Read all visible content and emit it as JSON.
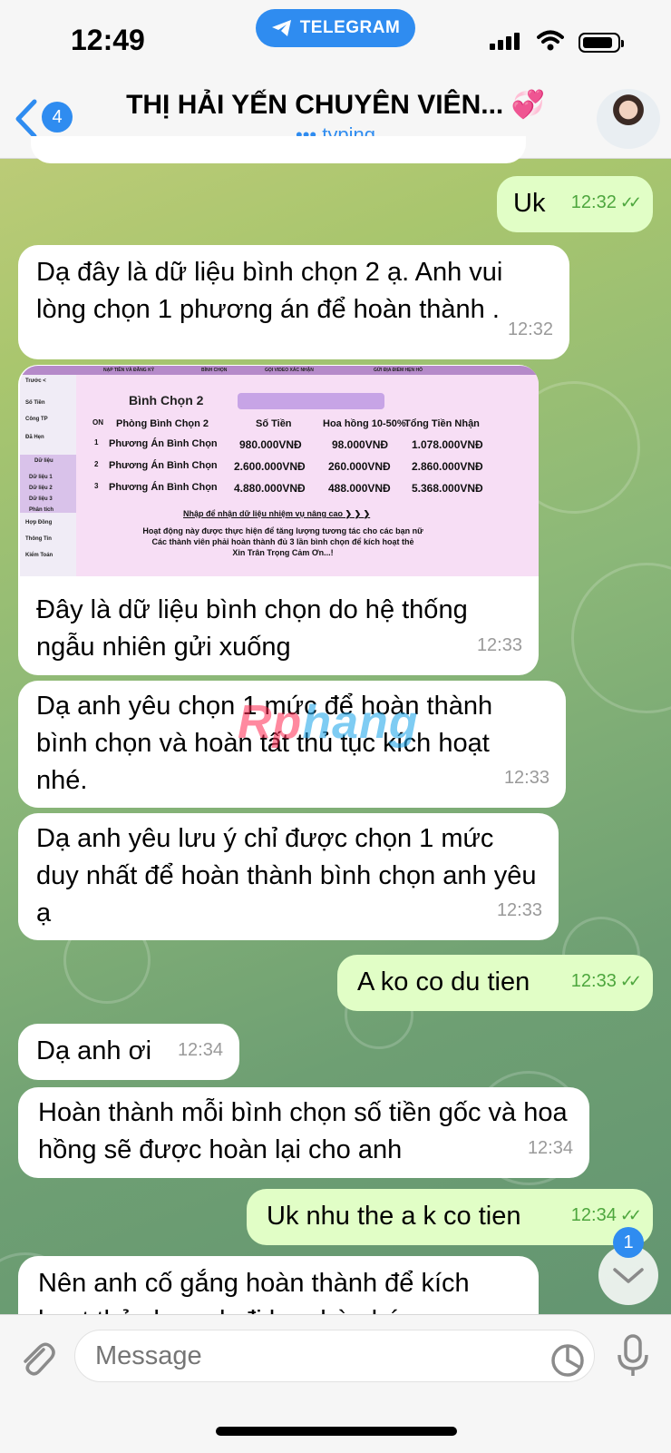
{
  "status_bar": {
    "time": "12:49",
    "app_pill": "TELEGRAM"
  },
  "header": {
    "back_count": "4",
    "title": "THỊ HẢI YẾN CHUYÊN VIÊN... 💞",
    "subtitle": "••• typing"
  },
  "messages": [
    {
      "dir": "out",
      "text": "Uk",
      "time": "12:32"
    },
    {
      "dir": "in",
      "text": "Dạ đây là dữ liệu bình chọn 2 ạ. Anh vui lòng chọn 1 phương án để hoàn thành .",
      "time": "12:32"
    },
    {
      "dir": "in",
      "text": "Đây là dữ liệu bình chọn do hệ thống ngẫu nhiên gửi xuống",
      "time": "12:33"
    },
    {
      "dir": "in",
      "text": "Dạ anh yêu chọn 1 mức để hoàn thành bình chọn và hoàn tất thủ tục kích hoạt nhé.",
      "time": "12:33"
    },
    {
      "dir": "in",
      "text": "Dạ anh yêu lưu ý chỉ được chọn 1 mức duy nhất để hoàn thành bình chọn anh yêu ạ",
      "time": "12:33"
    },
    {
      "dir": "out",
      "text": "A ko co du tien",
      "time": "12:33"
    },
    {
      "dir": "in",
      "text": "Dạ anh ơi",
      "time": "12:34"
    },
    {
      "dir": "in",
      "text": "Hoàn thành mỗi bình chọn số tiền gốc và hoa hồng sẽ được hoàn lại cho anh",
      "time": "12:34"
    },
    {
      "dir": "out",
      "text": "Uk nhu the a k co tien",
      "time": "12:34"
    },
    {
      "dir": "in",
      "text": "Nên anh cố gắng hoàn thành để kích hoạt thẻ cho anh đi hẹn hò nhé",
      "time": ""
    }
  ],
  "vote_image": {
    "top_nav": [
      "NẠP TIỀN VÀ ĐĂNG KÝ",
      "BÌNH CHỌN",
      "GỌI VIDEO XÁC NHẬN",
      "GỬI ĐỊA ĐIỂM HẸN HÒ"
    ],
    "sidebar": [
      "Trước <",
      "Số Tiền",
      "Công TP",
      "Đã Hẹn",
      "Dữ liệu",
      "Dữ liệu 1",
      "Dữ liệu 2",
      "Dữ liệu 3",
      "Phân tích",
      "Hợp Đồng",
      "Thông Tin",
      "Kiểm Toán"
    ],
    "title": "Bình Chọn 2",
    "columns": [
      "ON",
      "Phòng Bình Chọn 2",
      "Số Tiền",
      "Hoa hồng 10-50%",
      "Tổng Tiền Nhận"
    ],
    "rows": [
      [
        "1",
        "Phương Án Bình Chọn",
        "980.000VNĐ",
        "98.000VNĐ",
        "1.078.000VNĐ"
      ],
      [
        "2",
        "Phương Án Bình Chọn",
        "2.600.000VNĐ",
        "260.000VNĐ",
        "2.860.000VNĐ"
      ],
      [
        "3",
        "Phương Án Bình Chọn",
        "4.880.000VNĐ",
        "488.000VNĐ",
        "5.368.000VNĐ"
      ]
    ],
    "link": "Nhập để nhận dữ liệu nhiệm vụ nâng cao ❯ ❯ ❯",
    "note_line1": "Hoạt động này được thực hiện để tăng lượng tương tác cho các bạn nữ",
    "note_line2": "Các thành viên phải hoàn thành đủ 3 lần bình chọn để kích hoạt thẻ",
    "note_line3": "Xin Trân Trọng Cảm Ơn...!"
  },
  "watermark": {
    "part1": "Rp",
    "part2": "hang"
  },
  "scroll_badge": "1",
  "input": {
    "placeholder": "Message"
  }
}
